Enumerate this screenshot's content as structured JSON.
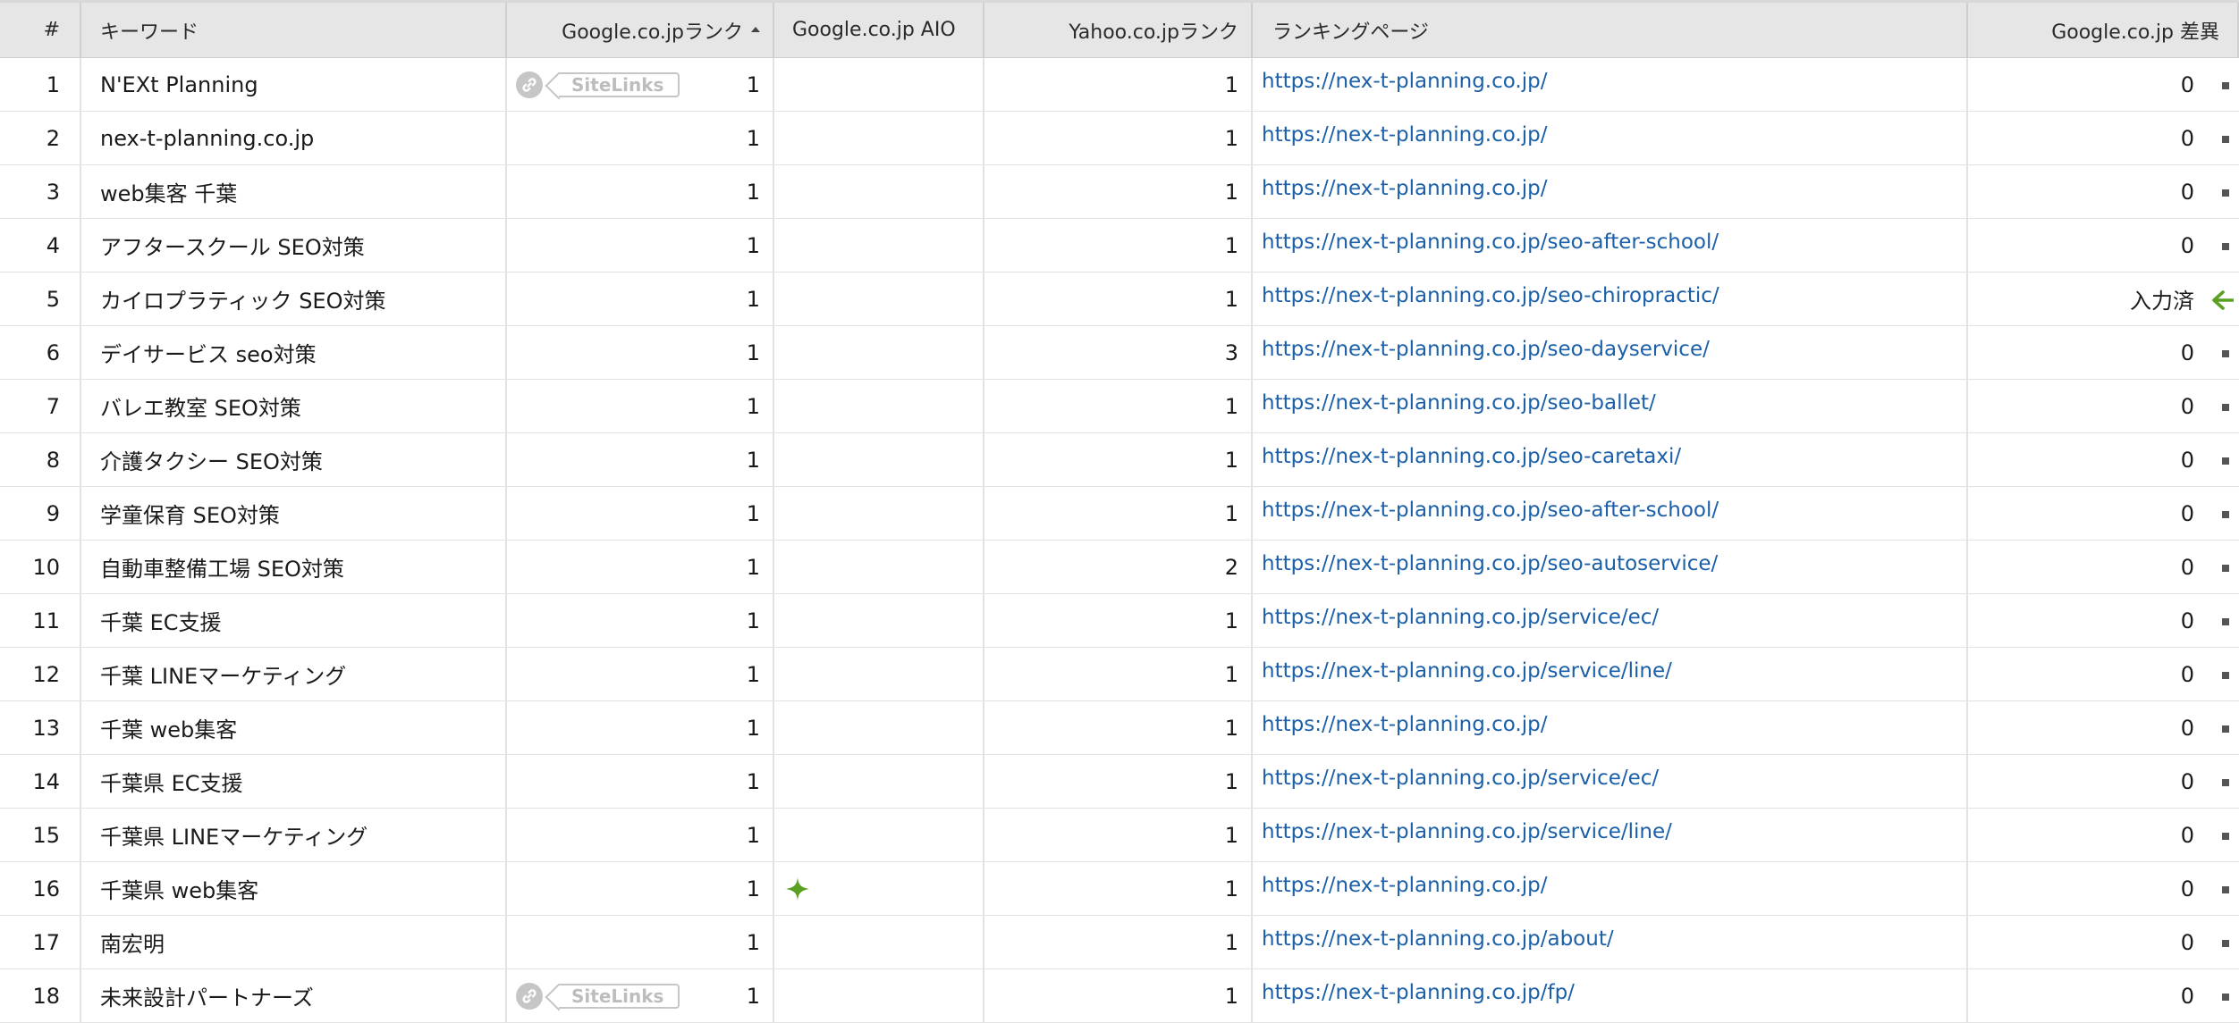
{
  "columns": {
    "num": "#",
    "keyword": "キーワード",
    "google_rank": "Google.co.jpランク",
    "google_aio": "Google.co.jp AIO",
    "yahoo_rank": "Yahoo.co.jpランク",
    "ranking_page": "ランキングページ",
    "google_diff": "Google.co.jp 差異"
  },
  "sort": {
    "column": "google_rank",
    "direction": "ascending"
  },
  "sitelinks_label": "SiteLinks",
  "colors": {
    "link": "#1a5fa8",
    "accent_green": "#5aa022",
    "header_bg": "#e6e6e6"
  },
  "rows": [
    {
      "num": "1",
      "keyword": "N'EXt Planning",
      "sitelinks": true,
      "google_rank": "1",
      "aio": false,
      "yahoo_rank": "1",
      "url": "https://nex-t-planning.co.jp/",
      "diff": "0",
      "diff_icon": "square-dot-icon"
    },
    {
      "num": "2",
      "keyword": "nex-t-planning.co.jp",
      "sitelinks": false,
      "google_rank": "1",
      "aio": false,
      "yahoo_rank": "1",
      "url": "https://nex-t-planning.co.jp/",
      "diff": "0",
      "diff_icon": "square-dot-icon"
    },
    {
      "num": "3",
      "keyword": "web集客 千葉",
      "sitelinks": false,
      "google_rank": "1",
      "aio": false,
      "yahoo_rank": "1",
      "url": "https://nex-t-planning.co.jp/",
      "diff": "0",
      "diff_icon": "square-dot-icon"
    },
    {
      "num": "4",
      "keyword": "アフタースクール SEO対策",
      "sitelinks": false,
      "google_rank": "1",
      "aio": false,
      "yahoo_rank": "1",
      "url": "https://nex-t-planning.co.jp/seo-after-school/",
      "diff": "0",
      "diff_icon": "square-dot-icon"
    },
    {
      "num": "5",
      "keyword": "カイロプラティック SEO対策",
      "sitelinks": false,
      "google_rank": "1",
      "aio": false,
      "yahoo_rank": "1",
      "url": "https://nex-t-planning.co.jp/seo-chiropractic/",
      "diff": "入力済",
      "diff_icon": "arrow-left-icon"
    },
    {
      "num": "6",
      "keyword": "デイサービス seo対策",
      "sitelinks": false,
      "google_rank": "1",
      "aio": false,
      "yahoo_rank": "3",
      "url": "https://nex-t-planning.co.jp/seo-dayservice/",
      "diff": "0",
      "diff_icon": "square-dot-icon"
    },
    {
      "num": "7",
      "keyword": "バレエ教室 SEO対策",
      "sitelinks": false,
      "google_rank": "1",
      "aio": false,
      "yahoo_rank": "1",
      "url": "https://nex-t-planning.co.jp/seo-ballet/",
      "diff": "0",
      "diff_icon": "square-dot-icon"
    },
    {
      "num": "8",
      "keyword": "介護タクシー SEO対策",
      "sitelinks": false,
      "google_rank": "1",
      "aio": false,
      "yahoo_rank": "1",
      "url": "https://nex-t-planning.co.jp/seo-caretaxi/",
      "diff": "0",
      "diff_icon": "square-dot-icon"
    },
    {
      "num": "9",
      "keyword": "学童保育 SEO対策",
      "sitelinks": false,
      "google_rank": "1",
      "aio": false,
      "yahoo_rank": "1",
      "url": "https://nex-t-planning.co.jp/seo-after-school/",
      "diff": "0",
      "diff_icon": "square-dot-icon"
    },
    {
      "num": "10",
      "keyword": "自動車整備工場 SEO対策",
      "sitelinks": false,
      "google_rank": "1",
      "aio": false,
      "yahoo_rank": "2",
      "url": "https://nex-t-planning.co.jp/seo-autoservice/",
      "diff": "0",
      "diff_icon": "square-dot-icon"
    },
    {
      "num": "11",
      "keyword": "千葉 EC支援",
      "sitelinks": false,
      "google_rank": "1",
      "aio": false,
      "yahoo_rank": "1",
      "url": "https://nex-t-planning.co.jp/service/ec/",
      "diff": "0",
      "diff_icon": "square-dot-icon"
    },
    {
      "num": "12",
      "keyword": "千葉 LINEマーケティング",
      "sitelinks": false,
      "google_rank": "1",
      "aio": false,
      "yahoo_rank": "1",
      "url": "https://nex-t-planning.co.jp/service/line/",
      "diff": "0",
      "diff_icon": "square-dot-icon"
    },
    {
      "num": "13",
      "keyword": "千葉 web集客",
      "sitelinks": false,
      "google_rank": "1",
      "aio": false,
      "yahoo_rank": "1",
      "url": "https://nex-t-planning.co.jp/",
      "diff": "0",
      "diff_icon": "square-dot-icon"
    },
    {
      "num": "14",
      "keyword": "千葉県 EC支援",
      "sitelinks": false,
      "google_rank": "1",
      "aio": false,
      "yahoo_rank": "1",
      "url": "https://nex-t-planning.co.jp/service/ec/",
      "diff": "0",
      "diff_icon": "square-dot-icon"
    },
    {
      "num": "15",
      "keyword": "千葉県 LINEマーケティング",
      "sitelinks": false,
      "google_rank": "1",
      "aio": false,
      "yahoo_rank": "1",
      "url": "https://nex-t-planning.co.jp/service/line/",
      "diff": "0",
      "diff_icon": "square-dot-icon"
    },
    {
      "num": "16",
      "keyword": "千葉県 web集客",
      "sitelinks": false,
      "google_rank": "1",
      "aio": true,
      "yahoo_rank": "1",
      "url": "https://nex-t-planning.co.jp/",
      "diff": "0",
      "diff_icon": "square-dot-icon"
    },
    {
      "num": "17",
      "keyword": "南宏明",
      "sitelinks": false,
      "google_rank": "1",
      "aio": false,
      "yahoo_rank": "1",
      "url": "https://nex-t-planning.co.jp/about/",
      "diff": "0",
      "diff_icon": "square-dot-icon"
    },
    {
      "num": "18",
      "keyword": "未来設計パートナーズ",
      "sitelinks": true,
      "google_rank": "1",
      "aio": false,
      "yahoo_rank": "1",
      "url": "https://nex-t-planning.co.jp/fp/",
      "diff": "0",
      "diff_icon": "square-dot-icon"
    }
  ]
}
